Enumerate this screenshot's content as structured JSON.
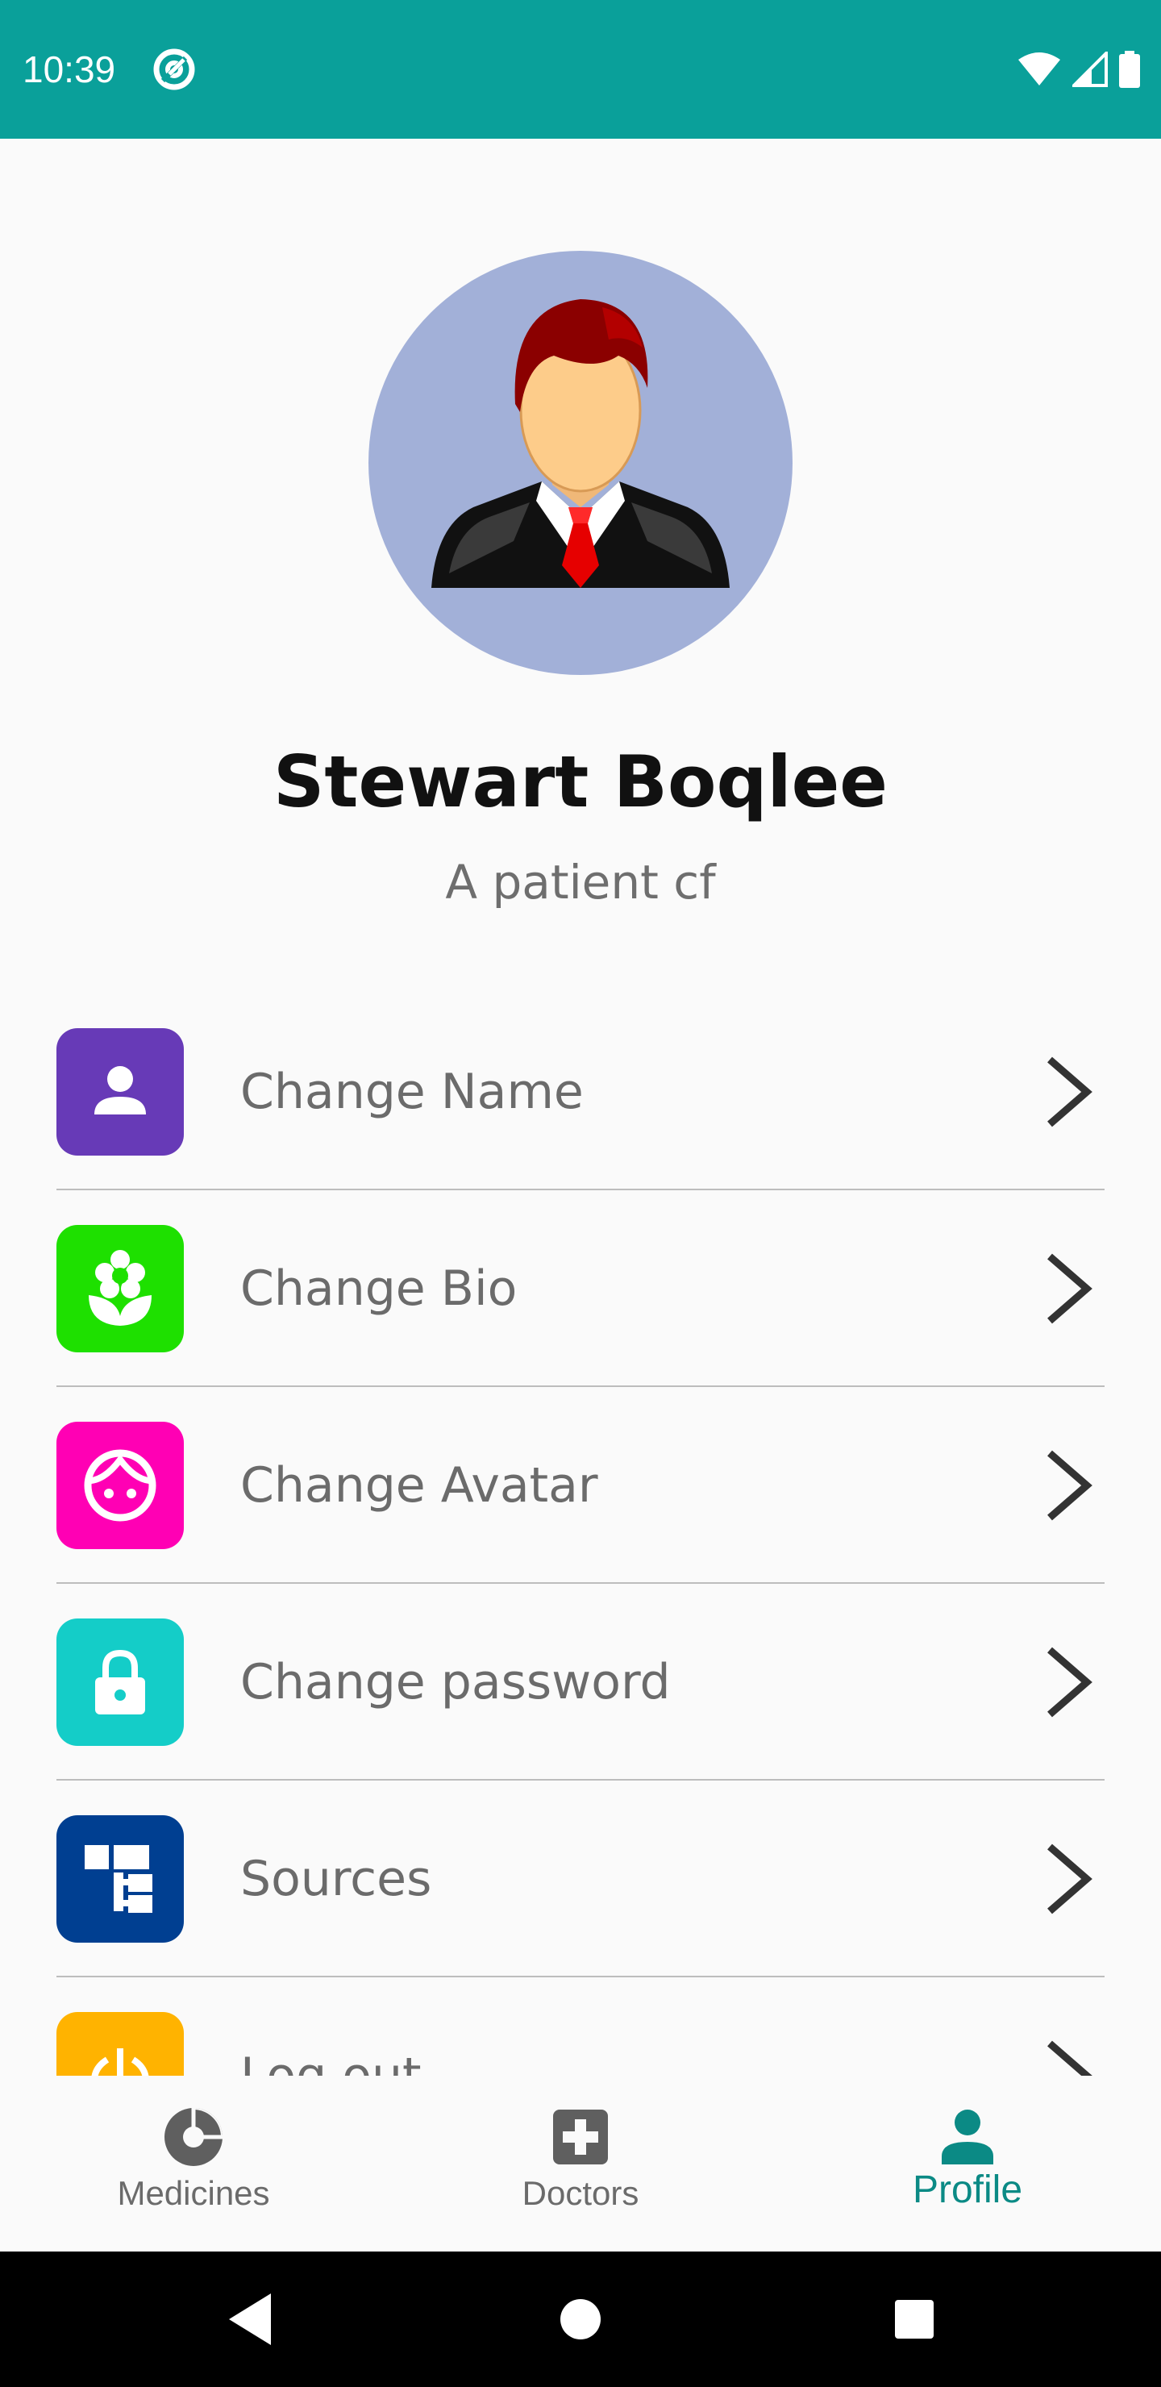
{
  "status_bar": {
    "time": "10:39",
    "background": "#0aa09a",
    "icons": [
      "at-sign-icon",
      "wifi-icon",
      "signal-icon",
      "battery-icon"
    ]
  },
  "profile": {
    "name": "Stewart Boqlee",
    "bio": "A patient cf",
    "avatar_icon": "businessman-avatar",
    "avatar_bg": "#a2b0d8"
  },
  "menu": {
    "items": [
      {
        "label": "Change Name",
        "icon": "person-icon",
        "color": "#673ab7"
      },
      {
        "label": "Change Bio",
        "icon": "flower-icon",
        "color": "#1ee000"
      },
      {
        "label": "Change Avatar",
        "icon": "face-icon",
        "color": "#ff00b4"
      },
      {
        "label": "Change password",
        "icon": "lock-icon",
        "color": "#14cdc8"
      },
      {
        "label": "Sources",
        "icon": "sitemap-icon",
        "color": "#003f91"
      },
      {
        "label": "Log out",
        "icon": "power-icon",
        "color": "#ffb300"
      }
    ]
  },
  "bottom_nav": {
    "items": [
      {
        "label": "Medicines",
        "icon": "pie-chart-icon",
        "active": false
      },
      {
        "label": "Doctors",
        "icon": "medical-cross-icon",
        "active": false
      },
      {
        "label": "Profile",
        "icon": "person-icon",
        "active": true
      }
    ],
    "active_color": "#0b8a85"
  },
  "system_nav": {
    "buttons": [
      "back-icon",
      "home-icon",
      "recents-icon"
    ]
  }
}
